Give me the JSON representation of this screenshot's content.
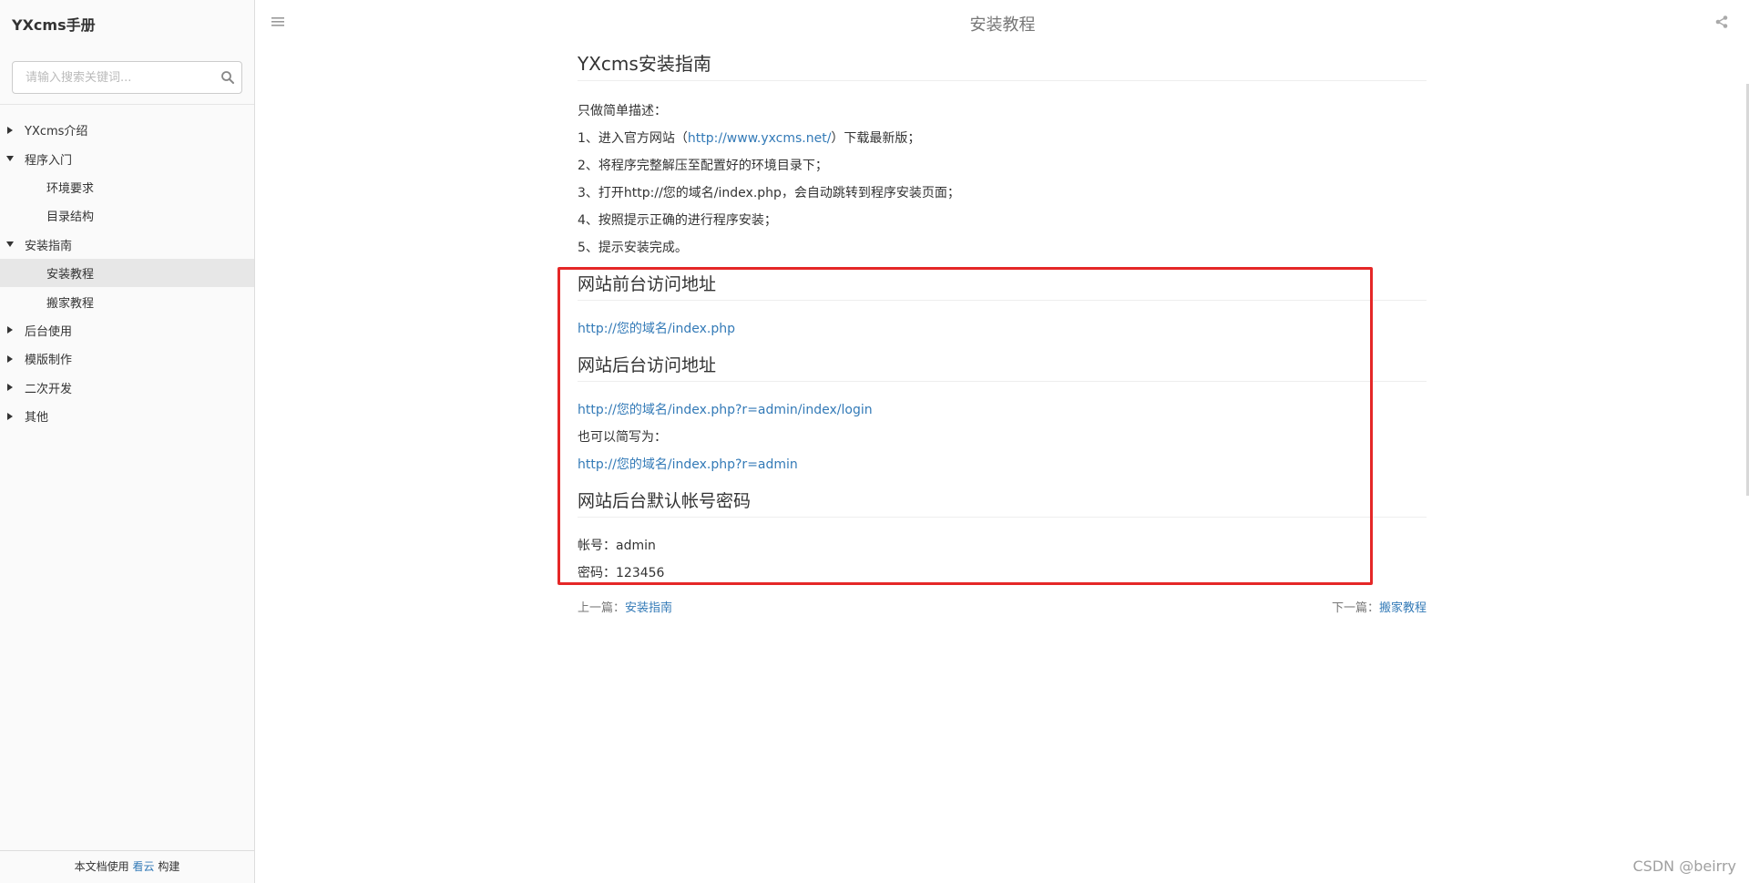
{
  "sidebar": {
    "brand": "YXcms手册",
    "search": {
      "placeholder": "请输入搜索关键词...",
      "value": ""
    },
    "items": [
      {
        "label": "YXcms介绍",
        "level": 1,
        "caret": "right"
      },
      {
        "label": "程序入门",
        "level": 1,
        "caret": "down"
      },
      {
        "label": "环境要求",
        "level": 2
      },
      {
        "label": "目录结构",
        "level": 2
      },
      {
        "label": "安装指南",
        "level": 1,
        "caret": "down"
      },
      {
        "label": "安装教程",
        "level": 2,
        "active": true
      },
      {
        "label": "搬家教程",
        "level": 2
      },
      {
        "label": "后台使用",
        "level": 1,
        "caret": "right"
      },
      {
        "label": "模版制作",
        "level": 1,
        "caret": "right"
      },
      {
        "label": "二次开发",
        "level": 1,
        "caret": "right"
      },
      {
        "label": "其他",
        "level": 1,
        "caret": "right"
      }
    ],
    "footer": {
      "prefix": "本文档使用 ",
      "link": "看云",
      "suffix": " 构建"
    }
  },
  "header": {
    "title": "安装教程"
  },
  "article": {
    "title": "YXcms安装指南",
    "intro": "只做简单描述：",
    "step1_prefix": "1、进入官方网站（",
    "step1_link": "http://www.yxcms.net/",
    "step1_suffix": "）下载最新版；",
    "step2": "2、将程序完整解压至配置好的环境目录下；",
    "step3": "3、打开http://您的域名/index.php，会自动跳转到程序安装页面；",
    "step4": "4、按照提示正确的进行程序安装；",
    "step5": "5、提示安装完成。",
    "front_heading": "网站前台访问地址",
    "front_url": "http://您的域名/index.php",
    "admin_heading": "网站后台访问地址",
    "admin_url": "http://您的域名/index.php?r=admin/index/login",
    "admin_short_label": "也可以简写为：",
    "admin_short_url": "http://您的域名/index.php?r=admin",
    "account_heading": "网站后台默认帐号密码",
    "account_line": "帐号：admin",
    "password_line": "密码：123456"
  },
  "pager": {
    "prev_label": "上一篇：",
    "prev_link": "安装指南",
    "next_label": "下一篇：",
    "next_link": "搬家教程"
  },
  "watermark": "CSDN @beirry",
  "colors": {
    "link": "#337ab7",
    "highlight": "#e52727",
    "sidebar_bg": "#fafafa",
    "active_bg": "#e7e7e7"
  },
  "icons": {
    "search": "search-icon",
    "menu": "menu-icon",
    "share": "share-icon",
    "caret_right": "caret-right-icon",
    "caret_down": "caret-down-icon"
  }
}
